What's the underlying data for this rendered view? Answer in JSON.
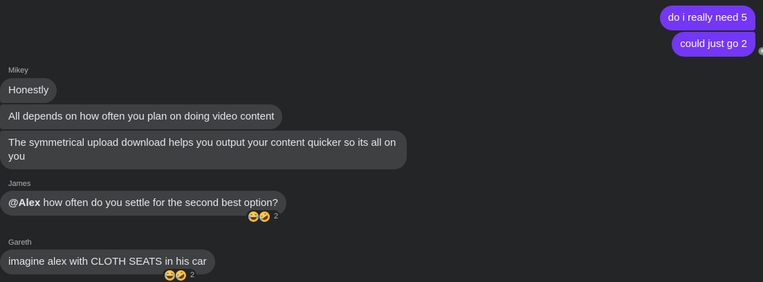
{
  "outgoing": [
    {
      "text": "do i really need 5"
    },
    {
      "text": "could just go 2"
    }
  ],
  "groups": [
    {
      "sender": "Mikey",
      "messages": [
        {
          "text": "Honestly"
        },
        {
          "text": "All depends on how often you plan on doing video content"
        },
        {
          "text": "The symmetrical upload download helps you output your content quicker so its all on you"
        }
      ]
    },
    {
      "sender": "James",
      "messages": [
        {
          "mention": "@Alex",
          "text": " how often do you settle for the second best option?",
          "reactions": {
            "icons": [
              "tears-of-joy-emoji",
              "rofl-emoji"
            ],
            "count": "2"
          }
        }
      ]
    },
    {
      "sender": "Gareth",
      "messages": [
        {
          "text": "imagine alex with CLOTH SEATS in his car",
          "reactions": {
            "icons": [
              "tears-of-joy-emoji",
              "rofl-emoji"
            ],
            "count": "2"
          }
        }
      ]
    }
  ],
  "colors": {
    "background": "#242526",
    "outgoing_bubble": "#7436f7",
    "incoming_bubble": "#3e4042",
    "text": "#e4e6eb",
    "sender_name": "#b0b3b8"
  }
}
